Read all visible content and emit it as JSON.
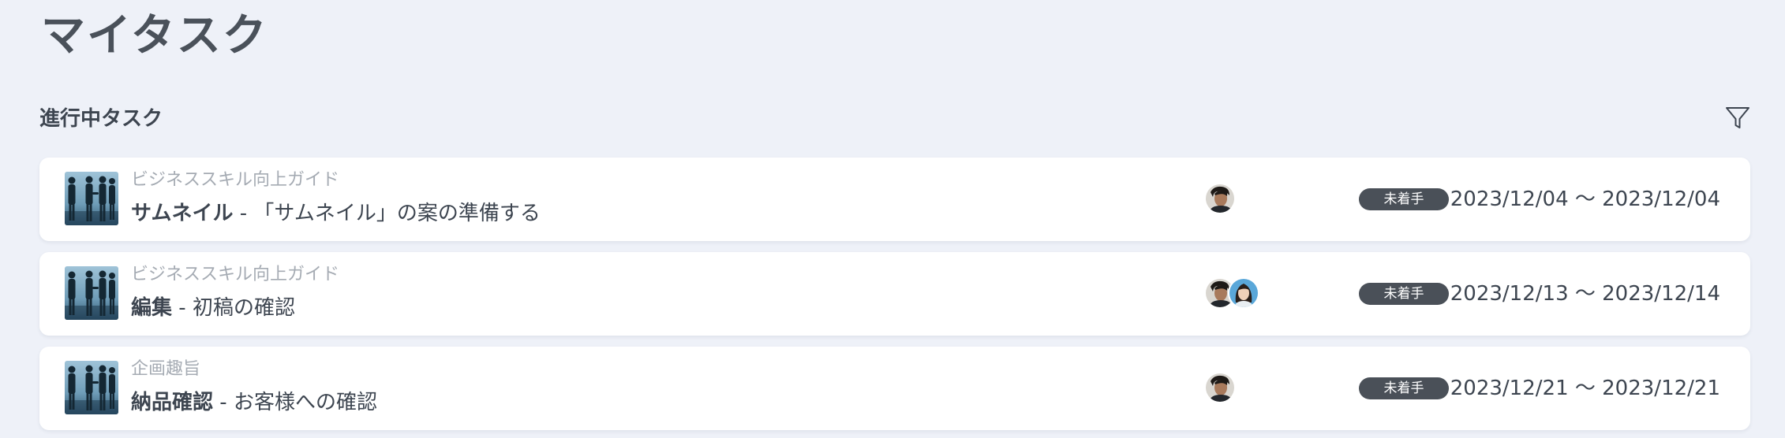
{
  "page": {
    "title": "マイタスク"
  },
  "section": {
    "title": "進行中タスク"
  },
  "icons": {
    "filter": "filter-icon",
    "thumbnail": "business-handshake-thumbnail",
    "avatar": "user-avatar"
  },
  "colors": {
    "background": "#eef1f8",
    "card": "#ffffff",
    "status_badge": "#4a5058"
  },
  "tasks": [
    {
      "project": "ビジネススキル向上ガイド",
      "category": "サムネイル",
      "separator": " - ",
      "title": "「サムネイル」の案の準備する",
      "assignees": [
        "assignee-man"
      ],
      "status": "未着手",
      "date_range": "2023/12/04 〜 2023/12/04"
    },
    {
      "project": "ビジネススキル向上ガイド",
      "category": "編集",
      "separator": " - ",
      "title": "初稿の確認",
      "assignees": [
        "assignee-man",
        "assignee-woman"
      ],
      "status": "未着手",
      "date_range": "2023/12/13 〜 2023/12/14"
    },
    {
      "project": "企画趣旨",
      "category": "納品確認",
      "separator": " - ",
      "title": "お客様への確認",
      "assignees": [
        "assignee-man"
      ],
      "status": "未着手",
      "date_range": "2023/12/21 〜 2023/12/21"
    }
  ]
}
